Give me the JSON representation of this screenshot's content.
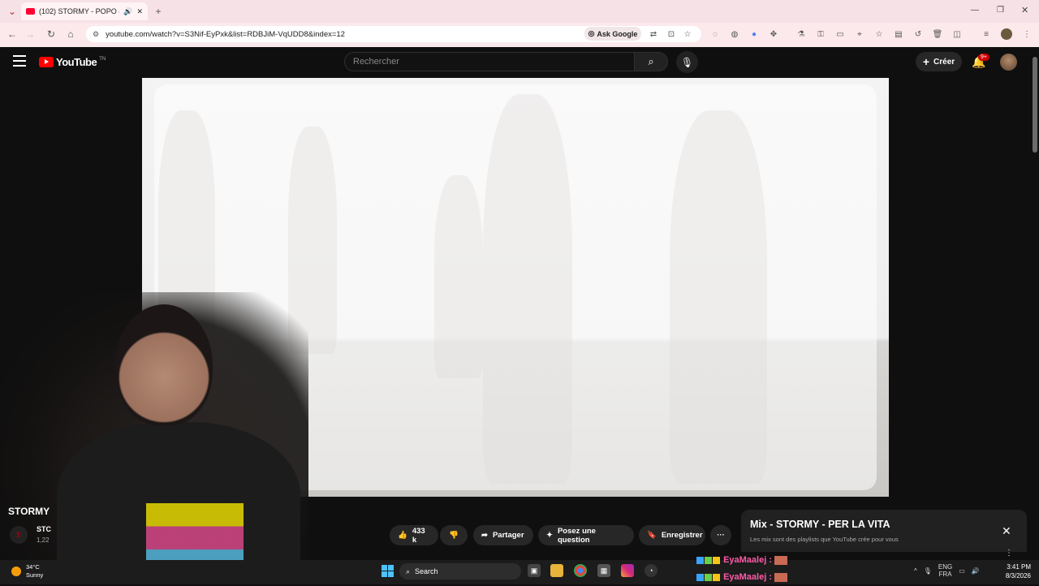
{
  "browser": {
    "tab_title": "(102) STORMY - POPO (M...",
    "url": "youtube.com/watch?v=S3Nif-EyPxk&list=RDBJiM-VqUDD8&index=12",
    "ask_google": "Ask Google"
  },
  "youtube": {
    "logo_text": "YouTube",
    "logo_sup": "TN",
    "search_placeholder": "Rechercher",
    "create_label": "Créer",
    "notif_count": "9+"
  },
  "video": {
    "title": "STORMY",
    "channel_abbrev": "STC",
    "subs_abbrev": "1,22",
    "likes": "433 k",
    "share_label": "Partager",
    "ask_label": "Posez une question",
    "save_label": "Enregistrer"
  },
  "mix_panel": {
    "title": "Mix - STORMY - PER LA VITA",
    "subtitle": "Les mix sont des playlists que YouTube crée pour vous"
  },
  "overlay": {
    "user1": "EyaMaalej :",
    "user2": "EyaMaalej :"
  },
  "taskbar": {
    "temperature": "34°C",
    "weather": "Sunny",
    "search_label": "Search",
    "lang_top": "ENG",
    "lang_bottom": "FRA",
    "time": "3:41 PM",
    "date": "8/3/2026"
  }
}
